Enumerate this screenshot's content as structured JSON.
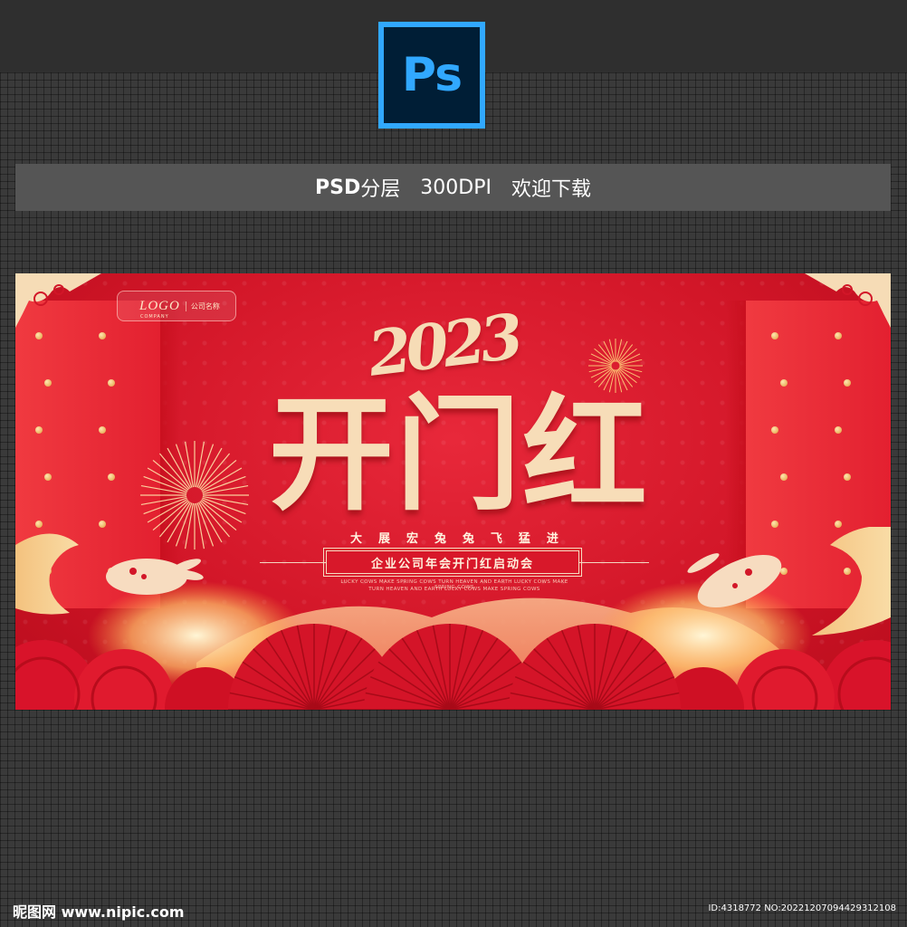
{
  "header": {
    "app_badge": "Ps",
    "format_label": "PSD",
    "layer_label": "分层",
    "dpi_label": "300DPI",
    "download_label": "欢迎下载"
  },
  "poster": {
    "logo_text": "LOGO",
    "logo_subtext": "COMPANY",
    "company_name": "公司名称",
    "year": "2023",
    "title": "开门红",
    "slogan": [
      "大",
      "展",
      "宏",
      "兔",
      "兔",
      "飞",
      "猛",
      "进"
    ],
    "event_name": "企业公司年会开门红启动会",
    "english_line_1": "LUCKY COWS MAKE SPRING COWS TURN HEAVEN AND EARTH LUCKY COWS MAKE SPRING COWS",
    "english_line_2": "TURN HEAVEN AND EARTH LUCKY COWS MAKE SPRING COWS",
    "colors": {
      "red": "#d21628",
      "gold": "#f7ddb8",
      "glow": "#ffd27a"
    },
    "decor_icons": [
      "firework-icon",
      "rabbit-icon",
      "cloud-icon",
      "fan-icon",
      "wave-icon"
    ]
  },
  "footer": {
    "site_label": "昵图网 www.nipic.com",
    "id_label": "ID:4318772 NO:20221207094429312108"
  }
}
